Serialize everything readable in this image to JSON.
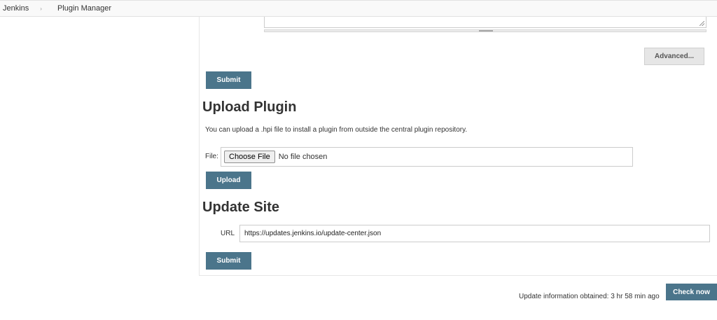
{
  "breadcrumb": {
    "items": [
      "Jenkins",
      "Plugin Manager"
    ],
    "separator": "›"
  },
  "advanced": {
    "button_label": "Advanced..."
  },
  "proxy_form": {
    "submit_label": "Submit"
  },
  "upload_plugin": {
    "title": "Upload Plugin",
    "description": "You can upload a .hpi file to install a plugin from outside the central plugin repository.",
    "file_label": "File:",
    "choose_file_label": "Choose File",
    "file_status": "No file chosen",
    "upload_label": "Upload"
  },
  "update_site": {
    "title": "Update Site",
    "url_label": "URL",
    "url_value": "https://updates.jenkins.io/update-center.json",
    "submit_label": "Submit"
  },
  "footer": {
    "status_text": "Update information obtained: 3 hr 58 min ago",
    "check_now_label": "Check now"
  },
  "colors": {
    "primary_button": "#4b758b",
    "secondary_button": "#e6e6e6",
    "breadcrumb_bg": "#f9f9f9"
  }
}
